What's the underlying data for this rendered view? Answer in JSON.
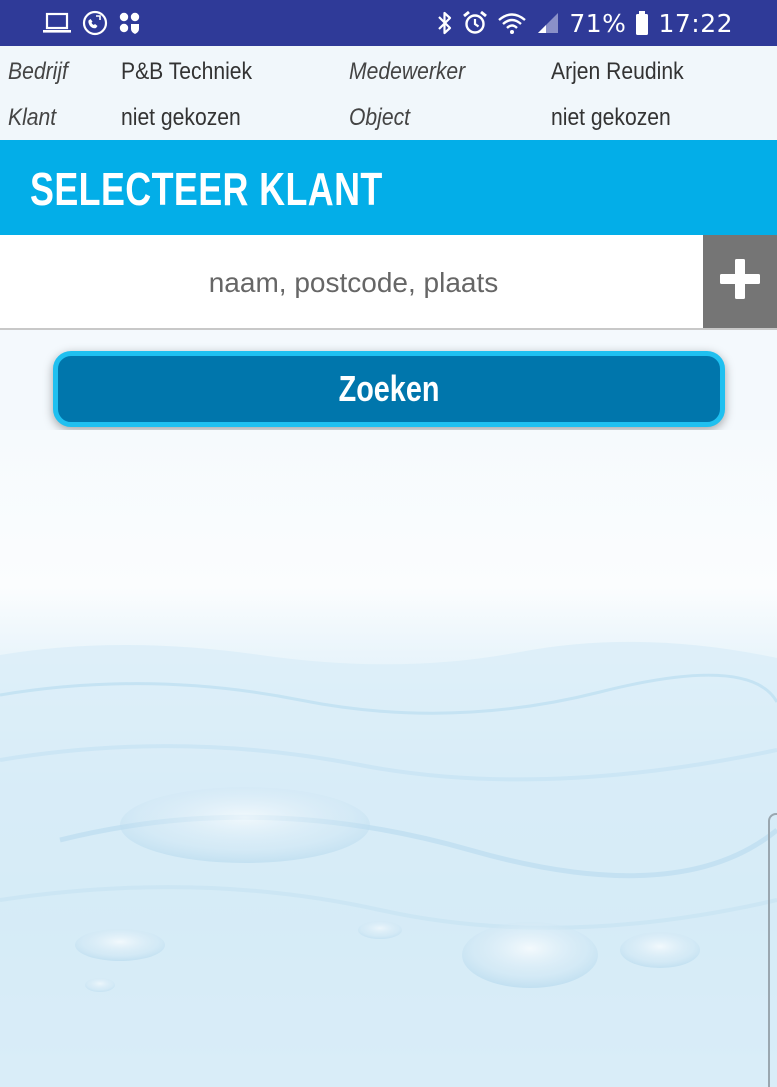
{
  "status_bar": {
    "battery_percent": "71%",
    "time": "17:22",
    "left_icons": [
      "laptop-icon",
      "phone-icon",
      "apps-icon"
    ],
    "right_icons": [
      "bluetooth-icon",
      "alarm-icon",
      "wifi-icon",
      "signal-icon",
      "battery-icon"
    ]
  },
  "info": {
    "bedrijf_label": "Bedrijf",
    "bedrijf_value": "P&B Techniek",
    "medewerker_label": "Medewerker",
    "medewerker_value": "Arjen Reudink",
    "klant_label": "Klant",
    "klant_value": "niet gekozen",
    "object_label": "Object",
    "object_value": "niet gekozen"
  },
  "page": {
    "title": "SELECTEER KLANT"
  },
  "search": {
    "placeholder": "naam, postcode, plaats",
    "value": "",
    "add_icon": "plus-icon"
  },
  "actions": {
    "search_label": "Zoeken"
  },
  "colors": {
    "status_bar": "#2f3a98",
    "title_bar": "#03aee8",
    "button_fill": "#0076ac",
    "button_border": "#1fc0f0",
    "add_button": "#757575"
  }
}
